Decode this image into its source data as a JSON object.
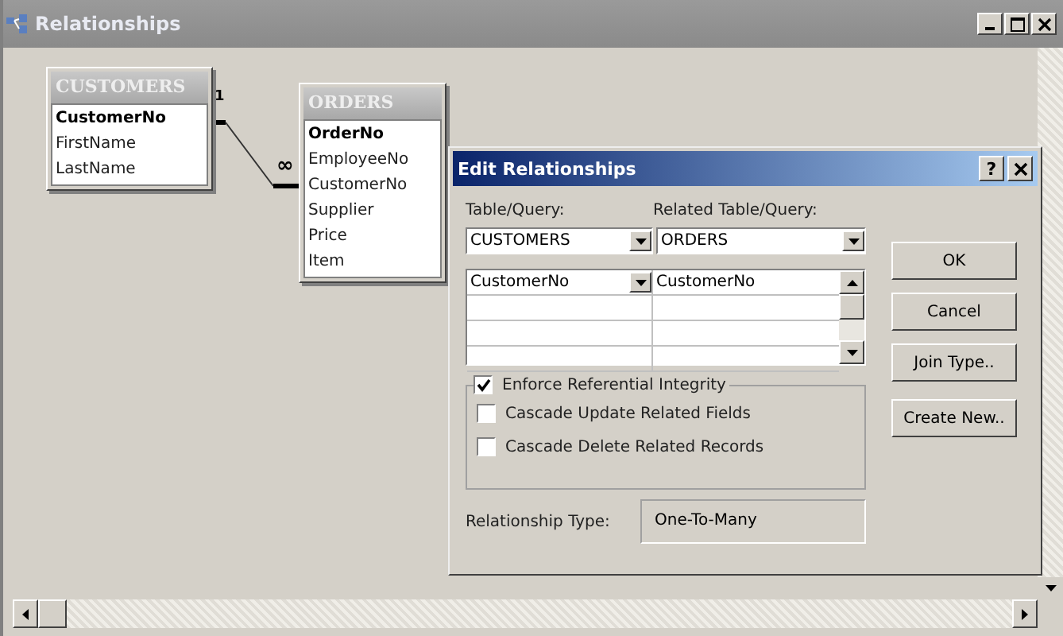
{
  "window": {
    "title": "Relationships"
  },
  "tables": [
    {
      "name": "CUSTOMERS",
      "fields": [
        {
          "name": "CustomerNo",
          "key": true
        },
        {
          "name": "FirstName",
          "key": false
        },
        {
          "name": "LastName",
          "key": false
        }
      ]
    },
    {
      "name": "ORDERS",
      "fields": [
        {
          "name": "OrderNo",
          "key": true
        },
        {
          "name": "EmployeeNo",
          "key": false
        },
        {
          "name": "CustomerNo",
          "key": false
        },
        {
          "name": "Supplier",
          "key": false
        },
        {
          "name": "Price",
          "key": false
        },
        {
          "name": "Item",
          "key": false
        }
      ]
    }
  ],
  "relationship": {
    "one_label": "1",
    "many_label": "∞"
  },
  "dialog": {
    "title": "Edit Relationships",
    "help": "?",
    "table_label": "Table/Query:",
    "table_value": "CUSTOMERS",
    "related_label": "Related Table/Query:",
    "related_value": "ORDERS",
    "grid_rows": [
      {
        "left": "CustomerNo",
        "right": "CustomerNo"
      }
    ],
    "checkboxes": [
      {
        "label": "Enforce Referential Integrity",
        "checked": true
      },
      {
        "label": "Cascade Update Related Fields",
        "checked": false
      },
      {
        "label": "Cascade Delete Related Records",
        "checked": false
      }
    ],
    "type_label": "Relationship Type:",
    "type_value": "One-To-Many",
    "buttons": [
      "OK",
      "Cancel",
      "Join Type..",
      "Create New.."
    ]
  }
}
